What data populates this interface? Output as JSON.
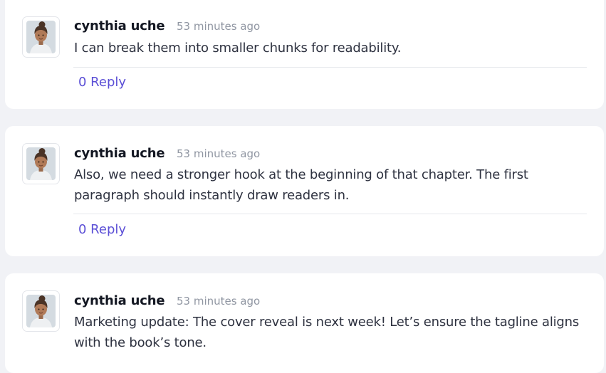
{
  "comments": [
    {
      "author": "cynthia uche",
      "time": "53 minutes ago",
      "text": "I can break them into smaller chunks for readability.",
      "reply_label": "0 Reply",
      "avatar_icon": "user-avatar-icon"
    },
    {
      "author": "cynthia uche",
      "time": "53 minutes ago",
      "text": "Also, we need a stronger hook at the beginning of that chapter. The first paragraph should instantly draw readers in.",
      "reply_label": "0 Reply",
      "avatar_icon": "user-avatar-icon"
    },
    {
      "author": "cynthia uche",
      "time": "53 minutes ago",
      "text": "Marketing update: The cover reveal is next week! Let’s ensure the tagline aligns with the book’s tone.",
      "reply_label": "",
      "avatar_icon": "user-avatar-icon"
    }
  ],
  "colors": {
    "page_background": "#f1f2f6",
    "card_background": "#ffffff",
    "reply_link": "#5b4fd6",
    "timestamp": "#9096a2"
  }
}
